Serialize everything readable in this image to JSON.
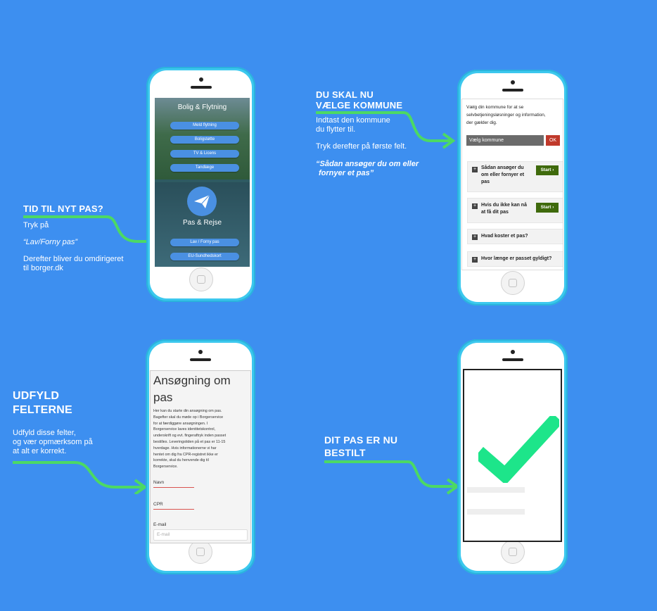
{
  "step1": {
    "heading": "TID TIL NYT PAS?",
    "line1": "Tryk på",
    "line2": "“Lav/Forny pas”",
    "line3a": "Derefter bliver du omdirigeret",
    "line3b": "til borger.dk",
    "screen": {
      "section_title": "Bolig & Flytning",
      "buttons": [
        "Meld flytning",
        "Boligstøtte",
        "TV & Licens",
        "Tandlæge"
      ],
      "pas_title": "Pas & Rejse",
      "pas_buttons": [
        "Lav / Forny pas",
        "EU-Sundhedskort"
      ]
    }
  },
  "step2": {
    "heading_line1": "DU SKAL NU",
    "heading_line2": "VÆLGE KOMMUNE",
    "line1a": "Indtast den kommune",
    "line1b": "du flytter til.",
    "line2": "Tryk derefter på første felt.",
    "line3a": "“Sådan ansøger du om eller",
    "line3b": "fornyer et pas”",
    "screen": {
      "intro_lines": [
        "Vælg din kommune for at se",
        "selvbetjeningsløsninger og information,",
        "der gælder dig."
      ],
      "select_label": "Vælg kommune",
      "ok_label": "OK",
      "accordion": [
        {
          "lines": [
            "Sådan ansøger du",
            "om eller fornyer et",
            "pas"
          ],
          "start": "Start"
        },
        {
          "lines": [
            "Hvis du ikke kan nå",
            "at få dit pas"
          ],
          "start": "Start"
        },
        {
          "lines": [
            "Hvad koster et pas?"
          ]
        },
        {
          "lines": [
            "Hvor længe er passet gyldigt?"
          ]
        }
      ]
    }
  },
  "step3": {
    "heading_line1": "UDFYLD",
    "heading_line2": "FELTERNE",
    "line1": "Udfyld disse felter,",
    "line2": "og vær opmærksom på",
    "line3": "at alt er korrekt.",
    "screen": {
      "title_line1": "Ansøgning om",
      "title_line2": "pas",
      "body_lines": [
        "Her kan du starte din ansøgning om pas.",
        "Bagefter skal du møde op i Borgerservice",
        "for at færdiggøre ansøgningen. I",
        "Borgerservice laves identitetskontrol,",
        "underskrift og evt. fingeraftryk inden passet",
        "bestilles. Leveringstiden på et pas er 11-15",
        "hverdage. Hvis informationerne vi har",
        "hentet om dig fra CPR-registret ikke er",
        "korrekte, skal du henvende dig til",
        "Borgerservice."
      ],
      "field_navn": "Navn",
      "field_cpr": "CPR",
      "field_email": "E-mail",
      "email_placeholder": "E-mail"
    }
  },
  "step4": {
    "heading_line1": "DIT PAS ER NU",
    "heading_line2": "BESTILT"
  },
  "colors": {
    "background": "#3d8ff0",
    "accent_green": "#4cd964",
    "phone": "#3cc8ee",
    "start_button": "#3f6a0c",
    "ok_button": "#c0392b"
  }
}
